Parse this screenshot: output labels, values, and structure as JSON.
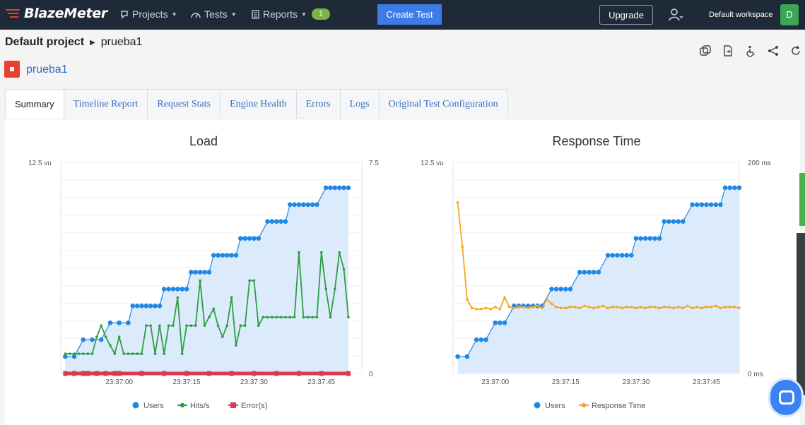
{
  "nav": {
    "logo": "BlazeMeter",
    "projects": "Projects",
    "tests": "Tests",
    "reports": "Reports",
    "reports_badge": "1",
    "create_test": "Create Test",
    "upgrade": "Upgrade",
    "workspace": "Default workspace",
    "avatar_initial": "D"
  },
  "breadcrumb": {
    "project": "Default project",
    "test": "prueba1"
  },
  "test_title": "prueba1",
  "tabs": [
    "Summary",
    "Timeline Report",
    "Request Stats",
    "Engine Health",
    "Errors",
    "Logs",
    "Original Test Configuration"
  ],
  "icons": [
    "copy-icon",
    "export-icon",
    "accessibility-icon",
    "share-icon",
    "refresh-icon",
    "user-add-icon",
    "stop-icon",
    "chat-icon"
  ],
  "colors": {
    "users": "#1e88e5",
    "hits": "#2e9e44",
    "errors": "#d83a52",
    "response": "#f5a623",
    "area": "#dcebfb",
    "nav": "#1f2a38",
    "accent": "#3d7be6"
  },
  "chart_data": [
    {
      "type": "line",
      "title": "Load",
      "y_left": {
        "max_label": "12.5 vu",
        "range": [
          0,
          12.5
        ]
      },
      "y_right": {
        "max_label": "7.5",
        "min_label": "0",
        "range": [
          0,
          7.5
        ]
      },
      "x_ticks": [
        "23:37:00",
        "23:37:15",
        "23:37:30",
        "23:37:45"
      ],
      "x_range": [
        -13,
        54
      ],
      "legend": [
        "Users",
        "Hits/s",
        "Error(s)"
      ],
      "series": [
        {
          "name": "Users",
          "axis": "left",
          "points": [
            [
              -12,
              1
            ],
            [
              -10,
              1
            ],
            [
              -8,
              2
            ],
            [
              -6,
              2
            ],
            [
              -4,
              2
            ],
            [
              -2,
              3
            ],
            [
              0,
              3
            ],
            [
              2,
              3
            ],
            [
              3,
              4
            ],
            [
              4,
              4
            ],
            [
              5,
              4
            ],
            [
              6,
              4
            ],
            [
              7,
              4
            ],
            [
              8,
              4
            ],
            [
              9,
              4
            ],
            [
              10,
              5
            ],
            [
              11,
              5
            ],
            [
              12,
              5
            ],
            [
              13,
              5
            ],
            [
              14,
              5
            ],
            [
              15,
              5
            ],
            [
              16,
              6
            ],
            [
              17,
              6
            ],
            [
              18,
              6
            ],
            [
              19,
              6
            ],
            [
              20,
              6
            ],
            [
              21,
              7
            ],
            [
              22,
              7
            ],
            [
              23,
              7
            ],
            [
              24,
              7
            ],
            [
              25,
              7
            ],
            [
              26,
              7
            ],
            [
              27,
              8
            ],
            [
              28,
              8
            ],
            [
              29,
              8
            ],
            [
              30,
              8
            ],
            [
              31,
              8
            ],
            [
              33,
              9
            ],
            [
              34,
              9
            ],
            [
              35,
              9
            ],
            [
              36,
              9
            ],
            [
              37,
              9
            ],
            [
              38,
              10
            ],
            [
              39,
              10
            ],
            [
              40,
              10
            ],
            [
              41,
              10
            ],
            [
              42,
              10
            ],
            [
              43,
              10
            ],
            [
              44,
              10
            ],
            [
              46,
              11
            ],
            [
              47,
              11
            ],
            [
              48,
              11
            ],
            [
              49,
              11
            ],
            [
              50,
              11
            ],
            [
              51,
              11
            ]
          ]
        },
        {
          "name": "Hits/s",
          "axis": "right",
          "points": [
            [
              -12,
              0.7
            ],
            [
              -11,
              0.7
            ],
            [
              -10,
              0.7
            ],
            [
              -9,
              0.7
            ],
            [
              -8,
              0.7
            ],
            [
              -7,
              0.7
            ],
            [
              -6,
              0.7
            ],
            [
              -5,
              1.3
            ],
            [
              -4,
              1.7
            ],
            [
              -3,
              1.3
            ],
            [
              -2,
              1.0
            ],
            [
              -1,
              0.7
            ],
            [
              0,
              1.3
            ],
            [
              1,
              0.7
            ],
            [
              2,
              0.7
            ],
            [
              3,
              0.7
            ],
            [
              4,
              0.7
            ],
            [
              5,
              0.7
            ],
            [
              6,
              1.7
            ],
            [
              7,
              1.7
            ],
            [
              8,
              0.7
            ],
            [
              9,
              1.7
            ],
            [
              10,
              0.7
            ],
            [
              11,
              1.7
            ],
            [
              12,
              1.7
            ],
            [
              13,
              2.7
            ],
            [
              14,
              0.7
            ],
            [
              15,
              1.7
            ],
            [
              16,
              1.7
            ],
            [
              17,
              1.7
            ],
            [
              18,
              3.3
            ],
            [
              19,
              1.7
            ],
            [
              20,
              2.0
            ],
            [
              21,
              2.3
            ],
            [
              22,
              1.7
            ],
            [
              23,
              1.3
            ],
            [
              24,
              1.7
            ],
            [
              25,
              2.7
            ],
            [
              26,
              1.0
            ],
            [
              27,
              1.7
            ],
            [
              28,
              1.7
            ],
            [
              29,
              3.3
            ],
            [
              30,
              3.3
            ],
            [
              31,
              1.7
            ],
            [
              32,
              2.0
            ],
            [
              33,
              2.0
            ],
            [
              34,
              2.0
            ],
            [
              35,
              2.0
            ],
            [
              36,
              2.0
            ],
            [
              37,
              2.0
            ],
            [
              38,
              2.0
            ],
            [
              39,
              2.0
            ],
            [
              40,
              4.3
            ],
            [
              41,
              2.0
            ],
            [
              42,
              2.0
            ],
            [
              43,
              2.0
            ],
            [
              44,
              2.0
            ],
            [
              45,
              4.3
            ],
            [
              46,
              3.0
            ],
            [
              47,
              2.0
            ],
            [
              48,
              3.0
            ],
            [
              49,
              4.3
            ],
            [
              50,
              3.7
            ],
            [
              51,
              2.0
            ]
          ]
        },
        {
          "name": "Error(s)",
          "axis": "right",
          "points": [
            [
              -12,
              0
            ],
            [
              -10,
              0
            ],
            [
              -8,
              0
            ],
            [
              -7,
              0
            ],
            [
              -5,
              0
            ],
            [
              -3,
              0
            ],
            [
              -1,
              0
            ],
            [
              0,
              0
            ],
            [
              5,
              0
            ],
            [
              10,
              0
            ],
            [
              15,
              0
            ],
            [
              20,
              0
            ],
            [
              25,
              0
            ],
            [
              30,
              0
            ],
            [
              35,
              0
            ],
            [
              40,
              0
            ],
            [
              45,
              0
            ],
            [
              51,
              0
            ]
          ]
        }
      ]
    },
    {
      "type": "line",
      "title": "Response Time",
      "y_left": {
        "max_label": "12.5 vu",
        "range": [
          0,
          12.5
        ]
      },
      "y_right": {
        "max_label": "200 ms",
        "min_label": "0 ms",
        "range": [
          0,
          200
        ]
      },
      "x_ticks": [
        "23:37:00",
        "23:37:15",
        "23:37:30",
        "23:37:45"
      ],
      "x_range": [
        -9,
        52
      ],
      "legend": [
        "Users",
        "Response Time"
      ],
      "series": [
        {
          "name": "Users",
          "axis": "left",
          "points": [
            [
              -8,
              1
            ],
            [
              -6,
              1
            ],
            [
              -4,
              2
            ],
            [
              -3,
              2
            ],
            [
              -2,
              2
            ],
            [
              0,
              3
            ],
            [
              1,
              3
            ],
            [
              2,
              3
            ],
            [
              4,
              4
            ],
            [
              5,
              4
            ],
            [
              6,
              4
            ],
            [
              7,
              4
            ],
            [
              8,
              4
            ],
            [
              9,
              4
            ],
            [
              10,
              4
            ],
            [
              12,
              5
            ],
            [
              13,
              5
            ],
            [
              14,
              5
            ],
            [
              15,
              5
            ],
            [
              16,
              5
            ],
            [
              18,
              6
            ],
            [
              19,
              6
            ],
            [
              20,
              6
            ],
            [
              21,
              6
            ],
            [
              22,
              6
            ],
            [
              24,
              7
            ],
            [
              25,
              7
            ],
            [
              26,
              7
            ],
            [
              27,
              7
            ],
            [
              28,
              7
            ],
            [
              29,
              7
            ],
            [
              30,
              8
            ],
            [
              31,
              8
            ],
            [
              32,
              8
            ],
            [
              33,
              8
            ],
            [
              34,
              8
            ],
            [
              35,
              8
            ],
            [
              36,
              9
            ],
            [
              37,
              9
            ],
            [
              38,
              9
            ],
            [
              39,
              9
            ],
            [
              40,
              9
            ],
            [
              42,
              10
            ],
            [
              43,
              10
            ],
            [
              44,
              10
            ],
            [
              45,
              10
            ],
            [
              46,
              10
            ],
            [
              47,
              10
            ],
            [
              48,
              10
            ],
            [
              49,
              11
            ],
            [
              50,
              11
            ],
            [
              51,
              11
            ],
            [
              52,
              11
            ]
          ]
        },
        {
          "name": "Response Time",
          "axis": "right",
          "points": [
            [
              -8,
              162
            ],
            [
              -7,
              120
            ],
            [
              -6,
              70
            ],
            [
              -5,
              62
            ],
            [
              -4,
              61
            ],
            [
              -3,
              61
            ],
            [
              -2,
              62
            ],
            [
              -1,
              61
            ],
            [
              0,
              63
            ],
            [
              1,
              61
            ],
            [
              2,
              72
            ],
            [
              3,
              63
            ],
            [
              4,
              62
            ],
            [
              5,
              63
            ],
            [
              6,
              63
            ],
            [
              7,
              62
            ],
            [
              8,
              63
            ],
            [
              9,
              64
            ],
            [
              10,
              62
            ],
            [
              11,
              70
            ],
            [
              12,
              66
            ],
            [
              13,
              63
            ],
            [
              14,
              62
            ],
            [
              15,
              62
            ],
            [
              16,
              63
            ],
            [
              17,
              63
            ],
            [
              18,
              62
            ],
            [
              19,
              64
            ],
            [
              20,
              63
            ],
            [
              21,
              62
            ],
            [
              22,
              63
            ],
            [
              23,
              64
            ],
            [
              24,
              62
            ],
            [
              25,
              63
            ],
            [
              26,
              63
            ],
            [
              27,
              62
            ],
            [
              28,
              63
            ],
            [
              29,
              63
            ],
            [
              30,
              62
            ],
            [
              31,
              63
            ],
            [
              32,
              62
            ],
            [
              33,
              63
            ],
            [
              34,
              63
            ],
            [
              35,
              62
            ],
            [
              36,
              63
            ],
            [
              37,
              63
            ],
            [
              38,
              62
            ],
            [
              39,
              63
            ],
            [
              40,
              62
            ],
            [
              41,
              64
            ],
            [
              42,
              62
            ],
            [
              43,
              63
            ],
            [
              44,
              62
            ],
            [
              45,
              63
            ],
            [
              46,
              63
            ],
            [
              47,
              64
            ],
            [
              48,
              62
            ],
            [
              49,
              63
            ],
            [
              50,
              63
            ],
            [
              51,
              63
            ],
            [
              52,
              62
            ]
          ]
        }
      ]
    }
  ]
}
